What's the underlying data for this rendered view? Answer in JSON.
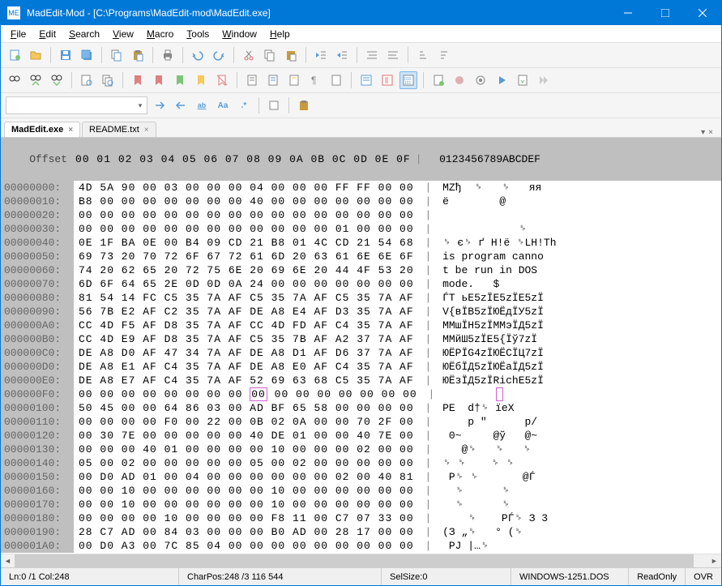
{
  "window": {
    "title": "MadEdit-Mod - [C:\\Programs\\MadEdit-mod\\MadEdit.exe]",
    "app_icon": "ME"
  },
  "menu": {
    "file": "File",
    "edit": "Edit",
    "search": "Search",
    "view": "View",
    "macro": "Macro",
    "tools": "Tools",
    "window": "Window",
    "help": "Help"
  },
  "toolbar_icons": {
    "new": "new-file",
    "open": "open-file",
    "save": "save",
    "saveall": "save-all",
    "copy": "copy",
    "cut": "cut",
    "paste": "paste",
    "print": "print",
    "undo": "undo",
    "redo": "redo",
    "find_binoc": "find",
    "find_next": "find-next",
    "find_prev": "find-prev",
    "replace": "replace",
    "goto": "goto",
    "bookmark_toggle": "bookmark-toggle",
    "bookmark_next": "bookmark-next",
    "bookmark_prev": "bookmark-prev",
    "bookmark_clear": "bookmark-clear",
    "indent_dec": "indent-decrease",
    "indent_inc": "indent-increase",
    "text_mode": "text-mode",
    "column_mode": "column-mode",
    "hex_mode": "hex-mode",
    "macro_rec": "macro-record",
    "macro_stop": "macro-stop",
    "macro_play": "macro-play",
    "case_toggle": "case-toggle",
    "regex_toggle": "regex-toggle"
  },
  "tabs": {
    "items": [
      {
        "label": "MadEdit.exe",
        "active": true
      },
      {
        "label": "README.txt",
        "active": false
      }
    ]
  },
  "hex": {
    "header_offset": "Offset",
    "header_cols": "00 01 02 03 04 05 06 07 08 09 0A 0B 0C 0D 0E 0F",
    "header_ascii": "0123456789ABCDEF",
    "rows": [
      {
        "off": "00000000:",
        "b": "4D 5A 90 00 03 00 00 00 04 00 00 00 FF FF 00 00",
        "a": "MZђ  ␠   ␠   яя  "
      },
      {
        "off": "00000010:",
        "b": "B8 00 00 00 00 00 00 00 40 00 00 00 00 00 00 00",
        "a": "ё        @       "
      },
      {
        "off": "00000020:",
        "b": "00 00 00 00 00 00 00 00 00 00 00 00 00 00 00 00",
        "a": "                "
      },
      {
        "off": "00000030:",
        "b": "00 00 00 00 00 00 00 00 00 00 00 00 01 00 00 00",
        "a": "            ␠   "
      },
      {
        "off": "00000040:",
        "b": "0E 1F BA 0E 00 B4 09 CD 21 B8 01 4C CD 21 54 68",
        "a": "␠ є␠ ґ Н!ё ␠LН!Th"
      },
      {
        "off": "00000050:",
        "b": "69 73 20 70 72 6F 67 72 61 6D 20 63 61 6E 6E 6F",
        "a": "is program canno"
      },
      {
        "off": "00000060:",
        "b": "74 20 62 65 20 72 75 6E 20 69 6E 20 44 4F 53 20",
        "a": "t be run in DOS "
      },
      {
        "off": "00000070:",
        "b": "6D 6F 64 65 2E 0D 0D 0A 24 00 00 00 00 00 00 00",
        "a": "mode.   $       "
      },
      {
        "off": "00000080:",
        "b": "81 54 14 FC C5 35 7A AF C5 35 7A AF C5 35 7A AF",
        "a": "ЃТ ьЕ5zЇЕ5zЇЕ5zЇ"
      },
      {
        "off": "00000090:",
        "b": "56 7B E2 AF C2 35 7A AF DE A8 E4 AF D3 35 7A AF",
        "a": "V{вЇВ5zЇЮЁдЇУ5zЇ"
      },
      {
        "off": "000000A0:",
        "b": "CC 4D F5 AF D8 35 7A AF CC 4D FD AF C4 35 7A AF",
        "a": "ММшЇН5zЇММэЇД5zЇ"
      },
      {
        "off": "000000B0:",
        "b": "CC 4D E9 AF D8 35 7A AF C5 35 7B AF A2 37 7A AF",
        "a": "ММйШ5zЇЕ5{Їў7zЇ"
      },
      {
        "off": "000000C0:",
        "b": "DE A8 D0 AF 47 34 7A AF DE A8 D1 AF D6 37 7A AF",
        "a": "ЮЁРЇG4zЇЮЁСЇЦ7zЇ"
      },
      {
        "off": "000000D0:",
        "b": "DE A8 E1 AF C4 35 7A AF DE A8 E0 AF C4 35 7A AF",
        "a": "ЮЁбЇД5zЇЮЁаЇД5zЇ"
      },
      {
        "off": "000000E0:",
        "b": "DE A8 E7 AF C4 35 7A AF 52 69 63 68 C5 35 7A AF",
        "a": "ЮЁзЇД5zЇRіchЕ5zЇ"
      },
      {
        "off": "000000F0:",
        "b": "00 00 00 00 00 00 00 00 ",
        "cursor_byte": "00",
        "b2": " 00 00 00 00 00 00 00",
        "a": "        ",
        "cursor_ascii": " ",
        "a2": "       "
      },
      {
        "off": "00000100:",
        "b": "50 45 00 00 64 86 03 00 AD BF 65 58 00 00 00 00",
        "a": "PE  d†␠ ­їeX    "
      },
      {
        "off": "00000110:",
        "b": "00 00 00 00 F0 00 22 00 0B 02 0A 00 00 70 2F 00",
        "a": "    р \"      p/ "
      },
      {
        "off": "00000120:",
        "b": "00 30 7E 00 00 00 00 00 40 DE 01 00 00 40 7E 00",
        "a": " 0~     @ў   @~ "
      },
      {
        "off": "00000130:",
        "b": "00 00 00 40 01 00 00 00 00 10 00 00 00 02 00 00",
        "a": "   @␠   ␠   ␠   "
      },
      {
        "off": "00000140:",
        "b": "05 00 02 00 00 00 00 00 05 00 02 00 00 00 00 00",
        "a": "␠ ␠    ␠ ␠      "
      },
      {
        "off": "00000150:",
        "b": "00 D0 AD 01 00 04 00 00 00 00 00 00 02 00 40 81",
        "a": " Р­␠ ␠       @Ѓ"
      },
      {
        "off": "00000160:",
        "b": "00 00 10 00 00 00 00 00 00 10 00 00 00 00 00 00",
        "a": "  ␠      ␠      "
      },
      {
        "off": "00000170:",
        "b": "00 00 10 00 00 00 00 00 00 10 00 00 00 00 00 00",
        "a": "  ␠      ␠      "
      },
      {
        "off": "00000180:",
        "b": "00 00 00 00 10 00 00 00 00 F8 11 00 C7 07 33 00",
        "a": "    ␠    РЃ␠ З 3 "
      },
      {
        "off": "00000190:",
        "b": "28 C7 AD 00 84 03 00 00 00 B0 AD 00 28 17 00 00",
        "a": "(З­ „␠   °­ (␠  "
      },
      {
        "off": "000001A0:",
        "b": "00 D0 A3 00 7C 85 04 00 00 00 00 00 00 00 00 00",
        "a": " РЈ |…␠         "
      }
    ]
  },
  "status": {
    "pos": "Ln:0 /1 Col:248",
    "charpos_label": "CharPos:",
    "charpos": "248 /3 116 544",
    "selsize_label": "SelSize:",
    "selsize": "0",
    "encoding": "WINDOWS-1251.DOS",
    "readonly": "ReadOnly",
    "ovr": "OVR"
  },
  "toolbar3": {
    "case_label": "Aa",
    "regex_label": ".*"
  }
}
